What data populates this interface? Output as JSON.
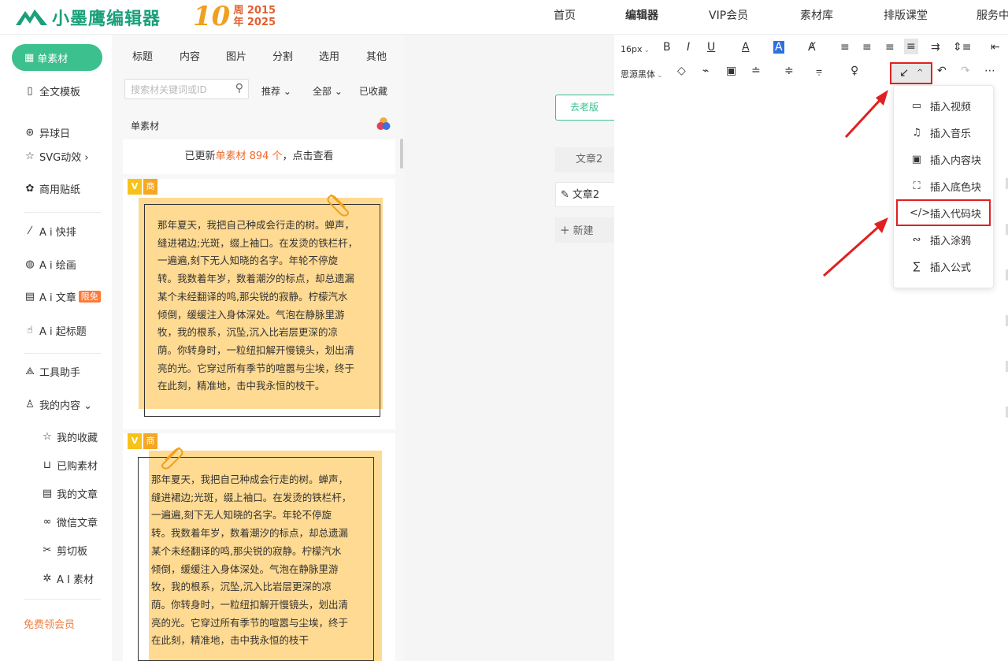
{
  "header": {
    "brand": "小墨鹰编辑器",
    "anniversary_number": "10",
    "anniversary_line1": "周 2015",
    "anniversary_line2": "年 2025",
    "nav": [
      "首页",
      "编辑器",
      "VIP会员",
      "素材库",
      "排版课堂",
      "服务中"
    ]
  },
  "sidebar": {
    "active": "单素材",
    "items": [
      "全文模板",
      "异球日",
      "SVG动效 ›",
      "商用贴纸",
      "A i 快排",
      "A i 绘画",
      "A i 文章",
      "A i 起标题",
      "工具助手",
      "我的内容 ⌄"
    ],
    "ai_article_badge": "限免",
    "sub_items": [
      "我的收藏",
      "已购素材",
      "我的文章",
      "微信文章",
      "剪切板",
      "A I 素材"
    ],
    "vip_link": "免费领会员"
  },
  "panel": {
    "tabs": [
      "标题",
      "内容",
      "图片",
      "分割",
      "选用",
      "其他"
    ],
    "search_placeholder": "搜索材关键词或ID",
    "filters": [
      "推荐 ⌄",
      "全部 ⌄",
      "已收藏"
    ],
    "section_title": "单素材",
    "update_prefix": "已更新",
    "update_highlight": "单素材 894 个",
    "update_suffix": "，点击查看",
    "card_tag_v": "V",
    "card_tag_s": "商",
    "card1_lines": [
      "那年夏天，我把自己种成会行走的树。蝉声，",
      "缝进裙边;光斑，缀上袖口。在发烫的铁栏杆，",
      "一遍遍,刻下无人知晓的名字。年轮不停旋",
      "转。我数着年岁，数着潮汐的标点，却总遗漏",
      "某个未经翻译的鸣,那尖锐的寂静。柠檬汽水",
      "倾倒，缓缓注入身体深处。气泡在静脉里游",
      "牧，我的根系，沉坠,沉入比岩层更深的凉",
      "荫。你转身时，一粒纽扣解开慢镜头，划出清",
      "亮的光。它穿过所有季节的喧嚣与尘埃，终于",
      "在此刻，精准地，击中我永恒的枝干。"
    ],
    "card2_lines": [
      "那年夏天，我把自己种成会行走的树。蝉声，",
      "缝进裙边;光斑，缀上袖口。在发烫的铁栏杆，",
      "一遍遍,刻下无人知晓的名字。年轮不停旋",
      "转。我数着年岁，数着潮汐的标点，却总遗漏",
      "某个未经翻译的鸣,那尖锐的寂静。柠檬汽水",
      "倾倒，缓缓注入身体深处。气泡在静脉里游",
      "牧，我的根系，沉坠,沉入比岩层更深的凉",
      "荫。你转身时，一粒纽扣解开慢镜头，划出清",
      "亮的光。它穿过所有季节的喧嚣与尘埃，终于",
      "在此刻，精准地，击中我永恒的枝干"
    ]
  },
  "middle": {
    "old_version": "去老版",
    "article_tab_1": "文章2",
    "article_tab_2": "文章2",
    "new_label": "新建"
  },
  "editor": {
    "font_size": "16px",
    "font_family": "思源黑体",
    "dropdown": [
      "插入视频",
      "插入音乐",
      "插入内容块",
      "插入底色块",
      "插入代码块",
      "插入涂鸦",
      "插入公式"
    ],
    "dropdown_icons": [
      "video-icon",
      "music-icon",
      "content-block-icon",
      "background-block-icon",
      "code-icon",
      "doodle-icon",
      "formula-icon"
    ]
  },
  "colors": {
    "brand_green": "#3cc08e",
    "highlight_red": "#e02020",
    "paper_yellow": "#ffda92",
    "accent_orange": "#f06a2a"
  }
}
